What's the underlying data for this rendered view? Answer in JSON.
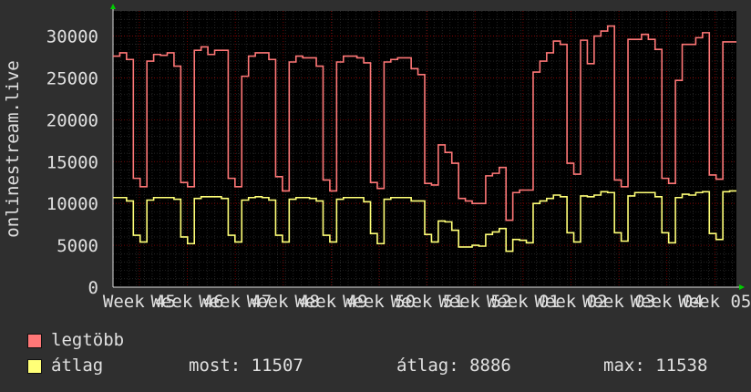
{
  "chart_data": {
    "type": "line",
    "ylabel": "onlinestream.live",
    "ylim": [
      0,
      33000
    ],
    "yticks": [
      0,
      5000,
      10000,
      15000,
      20000,
      25000,
      30000
    ],
    "xticks": [
      "Week 45",
      "Week 46",
      "Week 47",
      "Week 48",
      "Week 49",
      "Week 50",
      "Week 51",
      "Week 52",
      "Week 01",
      "Week 02",
      "Week 03",
      "Week 04",
      "Week 05"
    ],
    "grid": true,
    "background": "#000000",
    "grid_color": "#8b0000",
    "series": [
      {
        "name": "legtöbb",
        "color": "#ff7777",
        "values": [
          27600,
          28000,
          27200,
          13000,
          12000,
          27000,
          27800,
          27700,
          28000,
          26400,
          12500,
          12000,
          28300,
          28700,
          27800,
          28300,
          28300,
          13000,
          12000,
          25200,
          27600,
          28000,
          28000,
          27200,
          13200,
          11500,
          26900,
          27600,
          27400,
          27400,
          26400,
          12800,
          11500,
          26900,
          27600,
          27600,
          27400,
          26800,
          12500,
          11800,
          26900,
          27200,
          27400,
          27400,
          26100,
          25400,
          12400,
          12200,
          17000,
          16100,
          14800,
          10600,
          10300,
          10000,
          10000,
          13300,
          13600,
          14300,
          8000,
          11300,
          11600,
          11600,
          25700,
          27000,
          28000,
          29400,
          29000,
          14800,
          13500,
          29500,
          26700,
          30000,
          30600,
          31200,
          12800,
          12000,
          29600,
          29600,
          30200,
          29600,
          28400,
          13000,
          12400,
          24700,
          29000,
          29000,
          29800,
          30400,
          13400,
          12900,
          29300,
          29300
        ]
      },
      {
        "name": "átlag",
        "color": "#ffff77",
        "values": [
          10700,
          10700,
          10300,
          6200,
          5400,
          10400,
          10700,
          10700,
          10700,
          10500,
          6000,
          5200,
          10600,
          10800,
          10800,
          10800,
          10600,
          6200,
          5400,
          10400,
          10700,
          10800,
          10700,
          10400,
          6200,
          5400,
          10500,
          10700,
          10700,
          10600,
          10300,
          6200,
          5400,
          10500,
          10700,
          10700,
          10700,
          10200,
          6400,
          5200,
          10500,
          10700,
          10700,
          10700,
          10300,
          10300,
          6300,
          5400,
          7900,
          7800,
          6800,
          4800,
          4800,
          5000,
          4900,
          6300,
          6600,
          7000,
          4300,
          5700,
          5600,
          5300,
          10000,
          10300,
          10600,
          11000,
          10800,
          6500,
          5400,
          10900,
          10800,
          11000,
          11400,
          11300,
          6500,
          5500,
          10900,
          11300,
          11300,
          11300,
          10800,
          6500,
          5300,
          10700,
          11100,
          11000,
          11300,
          11400,
          6400,
          5700,
          11400,
          11500
        ]
      }
    ]
  },
  "legend": {
    "item1": "legtöbb",
    "item2": "átlag",
    "item1_color": "#ff7777",
    "item2_color": "#ffff77"
  },
  "stats": {
    "current": "most: 11507",
    "average": "átlag: 8886",
    "max": "max: 11538"
  }
}
